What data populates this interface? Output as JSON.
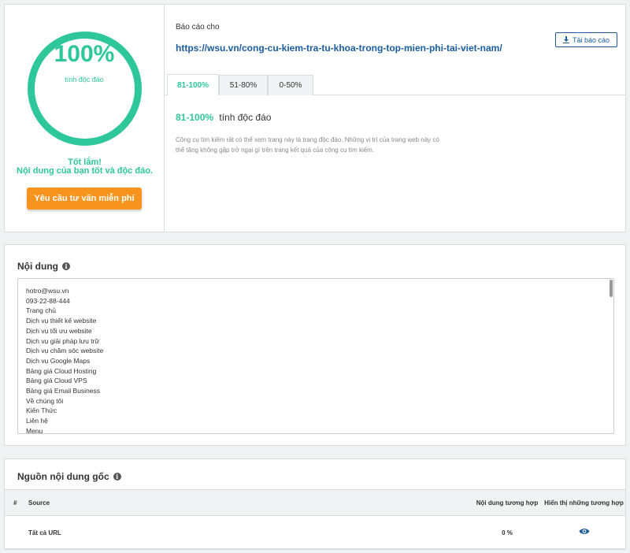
{
  "summary": {
    "score": "100%",
    "score_caption": "tính độc đáo",
    "verdict_title": "Tốt lắm!",
    "verdict_text": "Nội dung của bạn tốt và độc đáo.",
    "consult_label": "Yêu cầu tư vấn miễn phí",
    "accent_color": "#2ec79b",
    "button_color": "#f7941d"
  },
  "report": {
    "for_label": "Báo cáo cho",
    "url": "https://wsu.vn/cong-cu-kiem-tra-tu-khoa-trong-top-mien-phi-tai-viet-nam/",
    "download_label": "Tải báo cáo",
    "download_icon": "download-icon",
    "tabs": [
      {
        "label": "81-100%",
        "active": true
      },
      {
        "label": "51-80%",
        "active": false
      },
      {
        "label": "0-50%",
        "active": false
      }
    ],
    "tab_heading_range": "81-100%",
    "tab_heading_text": "tính độc đáo",
    "tab_description": "Công cụ tìm kiếm rất có thể xem trang này là trang độc đáo. Những vị trí của trang web này có thể tăng không gặp trở ngại gì trên trang kết quả của công cụ tìm kiếm."
  },
  "content": {
    "title": "Nội dung",
    "info_icon": "info-icon",
    "lines": [
      "hotro@wsu.vn",
      "093-22-88-444",
      "Trang chủ",
      "Dịch vụ thiết kế website",
      "Dịch vụ tối ưu website",
      "Dịch vụ giải pháp lưu trữ",
      "Dịch vụ chăm sóc website",
      "Dịch vụ Google Maps",
      "Bảng giá Cloud Hosting",
      "Bảng giá Cloud VPS",
      "Bảng giá Email Business",
      "Về chúng tôi",
      "Kiến Thức",
      "Liên hệ",
      "Menu"
    ]
  },
  "sources": {
    "title": "Nguồn nội dung gốc",
    "columns": {
      "num": "#",
      "source": "Source",
      "match": "Nội dung tương hợp",
      "show": "Hiển thị những tương hợp"
    },
    "rows": [
      {
        "num": "",
        "source": "Tất cả URL",
        "match": "0 %",
        "show_icon": "eye-icon"
      }
    ]
  }
}
